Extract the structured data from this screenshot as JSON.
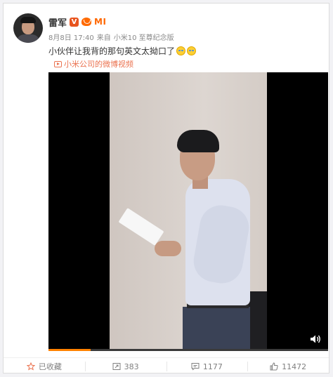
{
  "post": {
    "username": "雷军",
    "verified_badge": "V",
    "member_icon": "vip-member-icon",
    "brand_logo": "MI",
    "date": "8月8日 17:40",
    "source_prefix": "来自",
    "source": "小米10 至尊纪念版",
    "text": "小伙伴让我背的那句英文太拗口了",
    "emojis": [
      "tear-laugh-emoji",
      "tear-laugh-emoji"
    ],
    "video_link_label": "小米公司的微博视频"
  },
  "video": {
    "sound_icon": "speaker-icon",
    "progress_fraction": 0.15
  },
  "actions": {
    "favorite": {
      "icon": "star-icon",
      "label": "已收藏"
    },
    "repost": {
      "icon": "repost-icon",
      "count": "383"
    },
    "comment": {
      "icon": "comment-icon",
      "count": "1177"
    },
    "like": {
      "icon": "thumbs-up-icon",
      "count": "11472"
    }
  },
  "colors": {
    "accent_link": "#eb7350",
    "verified": "#e8541e",
    "mi_orange": "#ff6700"
  }
}
